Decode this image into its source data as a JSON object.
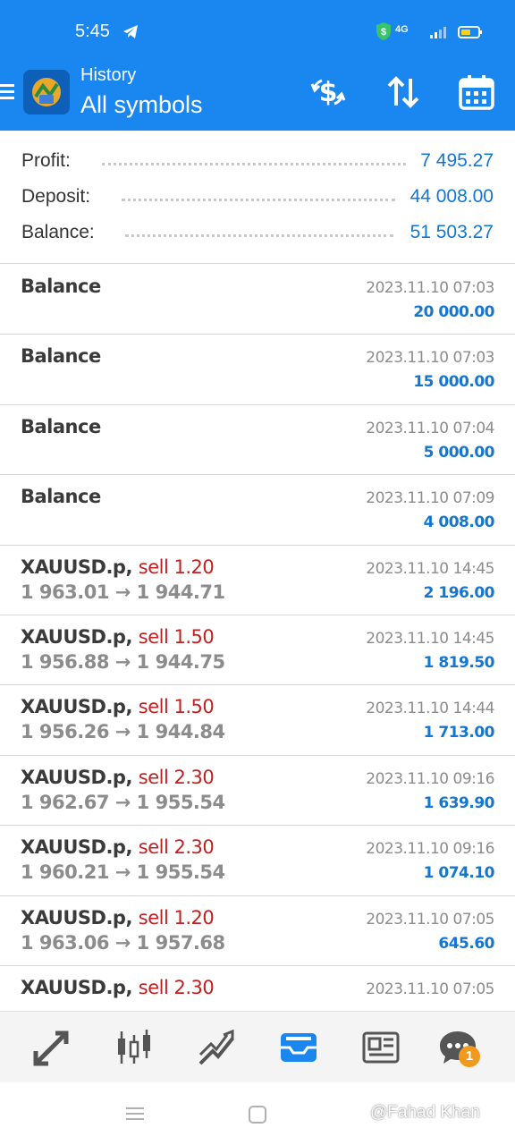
{
  "status_bar": {
    "time": "5:45",
    "network": "4G",
    "icons": [
      "telegram-icon",
      "shield-dollar-icon",
      "signal-icon",
      "battery-icon"
    ]
  },
  "header": {
    "subtitle": "History",
    "title": "All symbols",
    "actions": [
      "currency-exchange-icon",
      "sort-icon",
      "calendar-icon"
    ]
  },
  "summary": {
    "profit_label": "Profit:",
    "profit_value": "7 495.27",
    "deposit_label": "Deposit:",
    "deposit_value": "44 008.00",
    "balance_label": "Balance:",
    "balance_value": "51 503.27"
  },
  "rows": [
    {
      "title": "Balance",
      "date": "2023.11.10 07:03",
      "amount": "20 000.00"
    },
    {
      "title": "Balance",
      "date": "2023.11.10 07:03",
      "amount": "15 000.00"
    },
    {
      "title": "Balance",
      "date": "2023.11.10 07:04",
      "amount": "5 000.00"
    },
    {
      "title": "Balance",
      "date": "2023.11.10 07:09",
      "amount": "4 008.00"
    },
    {
      "title": "XAUUSD.p,",
      "sell": "sell 1.20",
      "prices": "1 963.01 → 1 944.71",
      "date": "2023.11.10 14:45",
      "amount": "2 196.00"
    },
    {
      "title": "XAUUSD.p,",
      "sell": "sell 1.50",
      "prices": "1 956.88 → 1 944.75",
      "date": "2023.11.10 14:45",
      "amount": "1 819.50"
    },
    {
      "title": "XAUUSD.p,",
      "sell": "sell 1.50",
      "prices": "1 956.26 → 1 944.84",
      "date": "2023.11.10 14:44",
      "amount": "1 713.00"
    },
    {
      "title": "XAUUSD.p,",
      "sell": "sell 2.30",
      "prices": "1 962.67 → 1 955.54",
      "date": "2023.11.10 09:16",
      "amount": "1 639.90"
    },
    {
      "title": "XAUUSD.p,",
      "sell": "sell 2.30",
      "prices": "1 960.21 → 1 955.54",
      "date": "2023.11.10 09:16",
      "amount": "1 074.10"
    },
    {
      "title": "XAUUSD.p,",
      "sell": "sell 1.20",
      "prices": "1 963.06 → 1 957.68",
      "date": "2023.11.10 07:05",
      "amount": "645.60"
    },
    {
      "title": "XAUUSD.p,",
      "sell": "sell 2.30",
      "prices": "",
      "date": "2023.11.10 07:05",
      "amount": ""
    }
  ],
  "bottom_nav": {
    "items": [
      "quotes-icon",
      "chart-icon",
      "trade-icon",
      "history-icon",
      "news-icon",
      "chat-icon"
    ],
    "active": "history-icon",
    "chat_badge": "1"
  },
  "watermark": "@Fahad Khan",
  "colors": {
    "accent": "#1a86f0",
    "value_blue": "#1576d0",
    "sell_red": "#c41f1f",
    "badge_orange": "#f19a1d"
  }
}
